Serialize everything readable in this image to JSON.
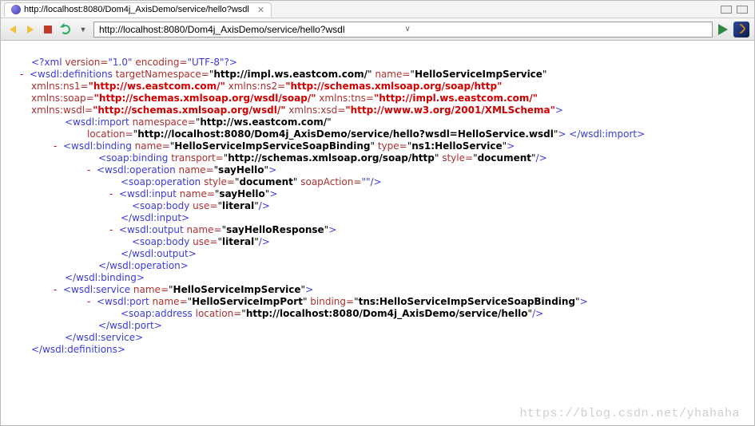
{
  "tab": {
    "title": "http://localhost:8080/Dom4j_AxisDemo/service/hello?wsdl",
    "close": "✕"
  },
  "url": "http://localhost:8080/Dom4j_AxisDemo/service/hello?wsdl",
  "xml": {
    "decl": {
      "open": "<?xml",
      "v_attr": " version=",
      "v_val": "\"1.0\"",
      "e_attr": " encoding=",
      "e_val": "\"UTF-8\"",
      "close": "?>"
    },
    "def_open": "<wsdl:definitions",
    "tns_attr": " targetNamespace=",
    "tns_val": "\"http://impl.ws.eastcom.com/\"",
    "name_attr": " name=",
    "name_val": "\"HelloServiceImpService\"",
    "ns1_attr": "xmlns:ns1=",
    "ns1_val": "\"http://ws.eastcom.com/\"",
    "ns2_attr": " xmlns:ns2=",
    "ns2_val": "\"http://schemas.xmlsoap.org/soap/http\"",
    "soap_attr": "xmlns:soap=",
    "soap_val": "\"http://schemas.xmlsoap.org/wsdl/soap/\"",
    "tnsx_attr": " xmlns:tns=",
    "tnsx_val": "\"http://impl.ws.eastcom.com/\"",
    "wsdl_attr": "xmlns:wsdl=",
    "wsdl_val": "\"http://schemas.xmlsoap.org/wsdl/\"",
    "xsd_attr": " xmlns:xsd=",
    "xsd_val": "\"http://www.w3.org/2001/XMLSchema\"",
    "gt": ">",
    "imp_open": "<wsdl:import",
    "imp_ns_attr": " namespace=",
    "imp_ns_val": "\"http://ws.eastcom.com/\"",
    "imp_loc_attr": "location=",
    "imp_loc_val": "\"http://localhost:8080/Dom4j_AxisDemo/service/hello?wsdl=HelloService.wsdl\"",
    "imp_close": " </wsdl:import>",
    "bind_open": "<wsdl:binding",
    "bind_name_val": "\"HelloServiceImpServiceSoapBinding\"",
    "type_attr": " type=",
    "bind_type_val": "\"ns1:HelloService\"",
    "sbind_open": "<soap:binding",
    "transport_attr": " transport=",
    "transport_val": "\"http://schemas.xmlsoap.org/soap/http\"",
    "style_attr": " style=",
    "style_val": "\"document\"",
    "sc": "/>",
    "op_open": "<wsdl:operation",
    "op_name_val": "\"sayHello\"",
    "sop_open": "<soap:operation",
    "saction_attr": " soapAction=",
    "saction_val": "\"\"",
    "in_open": "<wsdl:input",
    "in_name_val": "\"sayHello\"",
    "body_open": "<soap:body",
    "use_attr": " use=",
    "use_val": "\"literal\"",
    "in_close": "</wsdl:input>",
    "out_open": "<wsdl:output",
    "out_name_val": "\"sayHelloResponse\"",
    "out_close": "</wsdl:output>",
    "op_close": "</wsdl:operation>",
    "bind_close": "</wsdl:binding>",
    "svc_open": "<wsdl:service",
    "svc_name_val": "\"HelloServiceImpService\"",
    "port_open": "<wsdl:port",
    "port_name_val": "\"HelloServiceImpPort\"",
    "binding_attr": " binding=",
    "port_bind_val": "\"tns:HelloServiceImpServiceSoapBinding\"",
    "addr_open": "<soap:address",
    "loc_attr": " location=",
    "addr_val": "\"http://localhost:8080/Dom4j_AxisDemo/service/hello\"",
    "port_close": "</wsdl:port>",
    "svc_close": "</wsdl:service>",
    "def_close": "</wsdl:definitions>"
  },
  "minus": "-",
  "watermark": "https://blog.csdn.net/yhahaha"
}
